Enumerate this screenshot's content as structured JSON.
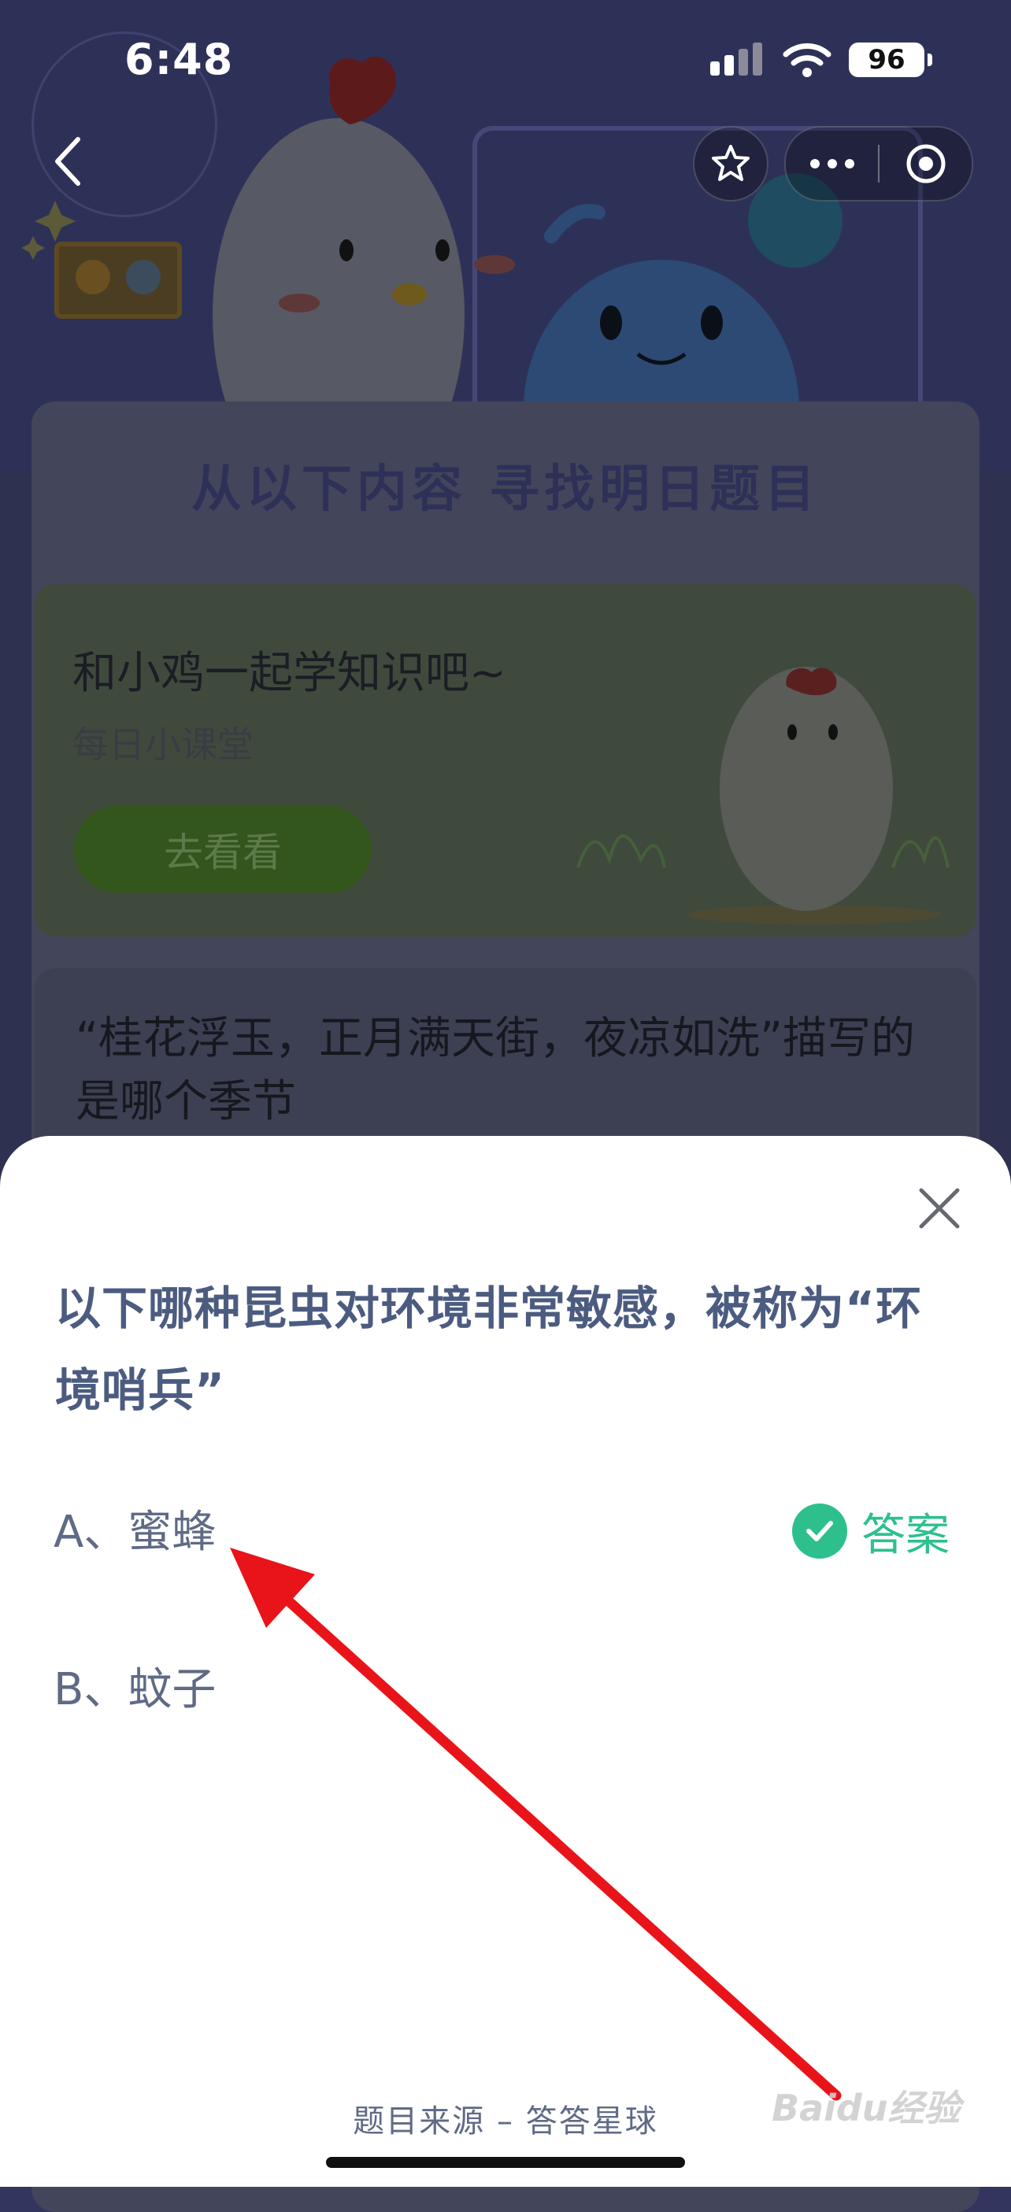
{
  "status_bar": {
    "time": "6:48",
    "battery": "96"
  },
  "background": {
    "title": "从以下内容 寻找明日题目",
    "lesson": {
      "title": "和小鸡一起学知识吧~",
      "subtitle": "每日小课堂",
      "button": "去看看"
    },
    "question": "“桂花浮玉，正月满天街，夜凉如洗”描写的是哪个季节"
  },
  "sheet": {
    "question": "以下哪种昆虫对环境非常敏感，被称为“环境哨兵”",
    "options": [
      {
        "label": "A、蜜蜂"
      },
      {
        "label": "B、蚊子"
      }
    ],
    "answer_label": "答案",
    "source": "题目来源 – 答答星球"
  },
  "watermark": "Baidu经验",
  "colors": {
    "accent_green": "#2dc08d",
    "annotation_arrow": "#e8141a",
    "question_text": "#4c5c80"
  }
}
